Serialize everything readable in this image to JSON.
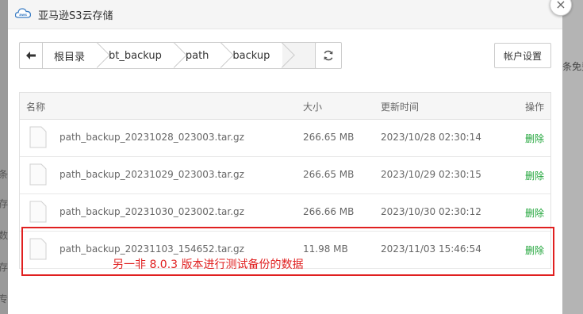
{
  "background": {
    "left_chars": [
      "条",
      "存",
      "数",
      "存",
      "专"
    ],
    "right_text": "条免费"
  },
  "dialog": {
    "title": "亚马逊S3云存储",
    "icon": "aws-cloud-icon",
    "close_icon": "close-icon"
  },
  "breadcrumb": {
    "back_icon": "arrow-left-icon",
    "items": [
      "根目录",
      "bt_backup",
      "path",
      "backup"
    ],
    "refresh_icon": "refresh-icon"
  },
  "toolbar": {
    "account_label": "帐户设置"
  },
  "table": {
    "headers": {
      "name": "名称",
      "size": "大小",
      "time": "更新时间",
      "op": "操作"
    },
    "rows": [
      {
        "name": "path_backup_20231028_023003.tar.gz",
        "size": "266.65 MB",
        "time": "2023/10/28 02:30:14",
        "op": "删除"
      },
      {
        "name": "path_backup_20231029_023003.tar.gz",
        "size": "266.65 MB",
        "time": "2023/10/29 02:30:15",
        "op": "删除"
      },
      {
        "name": "path_backup_20231030_023002.tar.gz",
        "size": "266.66 MB",
        "time": "2023/10/30 02:30:12",
        "op": "删除"
      },
      {
        "name": "path_backup_20231103_154652.tar.gz",
        "size": "11.98 MB",
        "time": "2023/11/03 15:46:54",
        "op": "删除"
      }
    ]
  },
  "annotation": {
    "text": "另一非 8.0.3 版本进行测试备份的数据",
    "color": "#e02020"
  },
  "colors": {
    "accent_green": "#20a53a"
  }
}
